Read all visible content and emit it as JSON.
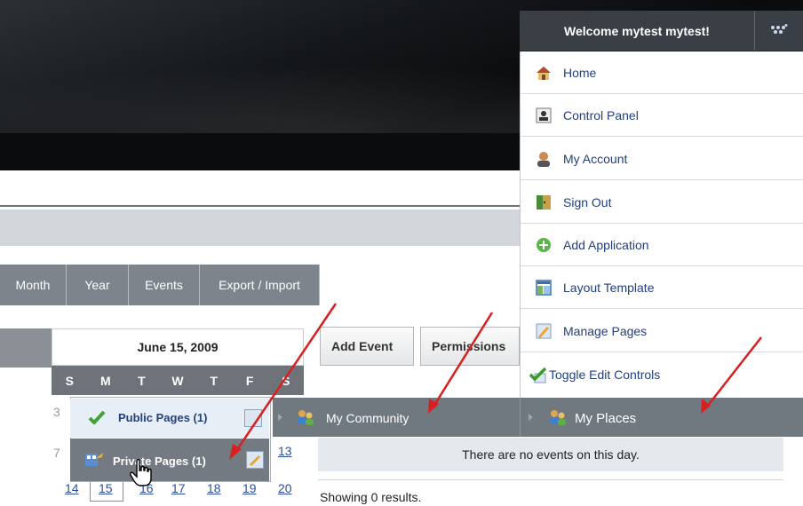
{
  "dock": {
    "welcome": "Welcome mytest mytest!"
  },
  "menu": [
    {
      "label": "Home",
      "icon": "home-icon"
    },
    {
      "label": "Control Panel",
      "icon": "control-panel-icon"
    },
    {
      "label": "My Account",
      "icon": "my-account-icon"
    },
    {
      "label": "Sign Out",
      "icon": "sign-out-icon"
    },
    {
      "label": "Add Application",
      "icon": "add-application-icon"
    },
    {
      "label": "Layout Template",
      "icon": "layout-template-icon"
    },
    {
      "label": "Manage Pages",
      "icon": "manage-pages-icon"
    },
    {
      "label": "Toggle Edit Controls",
      "icon": "toggle-edit-controls-icon"
    }
  ],
  "tabs": [
    "Month",
    "Year",
    "Events",
    "Export / Import"
  ],
  "calendar": {
    "title": "June 15, 2009",
    "weekdays": [
      "S",
      "M",
      "T",
      "W",
      "T",
      "F",
      "S"
    ],
    "row_partial_left": "3",
    "row_partial_left2": "7",
    "cell_13": "13",
    "last_row": [
      "14",
      "15",
      "16",
      "17",
      "18",
      "19",
      "20"
    ]
  },
  "actions": {
    "add_event": "Add Event",
    "permissions": "Permissions"
  },
  "places": {
    "public": "Public Pages (1)",
    "private": "Private Pages (1)",
    "community": "My Community",
    "my_places": "My Places"
  },
  "events": {
    "none": "There are no events on this day.",
    "showing": "Showing 0 results."
  },
  "colors": {
    "header": "#121416",
    "tab_bg": "#7d848b",
    "menu_link": "#23407e",
    "arrow": "#d82020"
  }
}
